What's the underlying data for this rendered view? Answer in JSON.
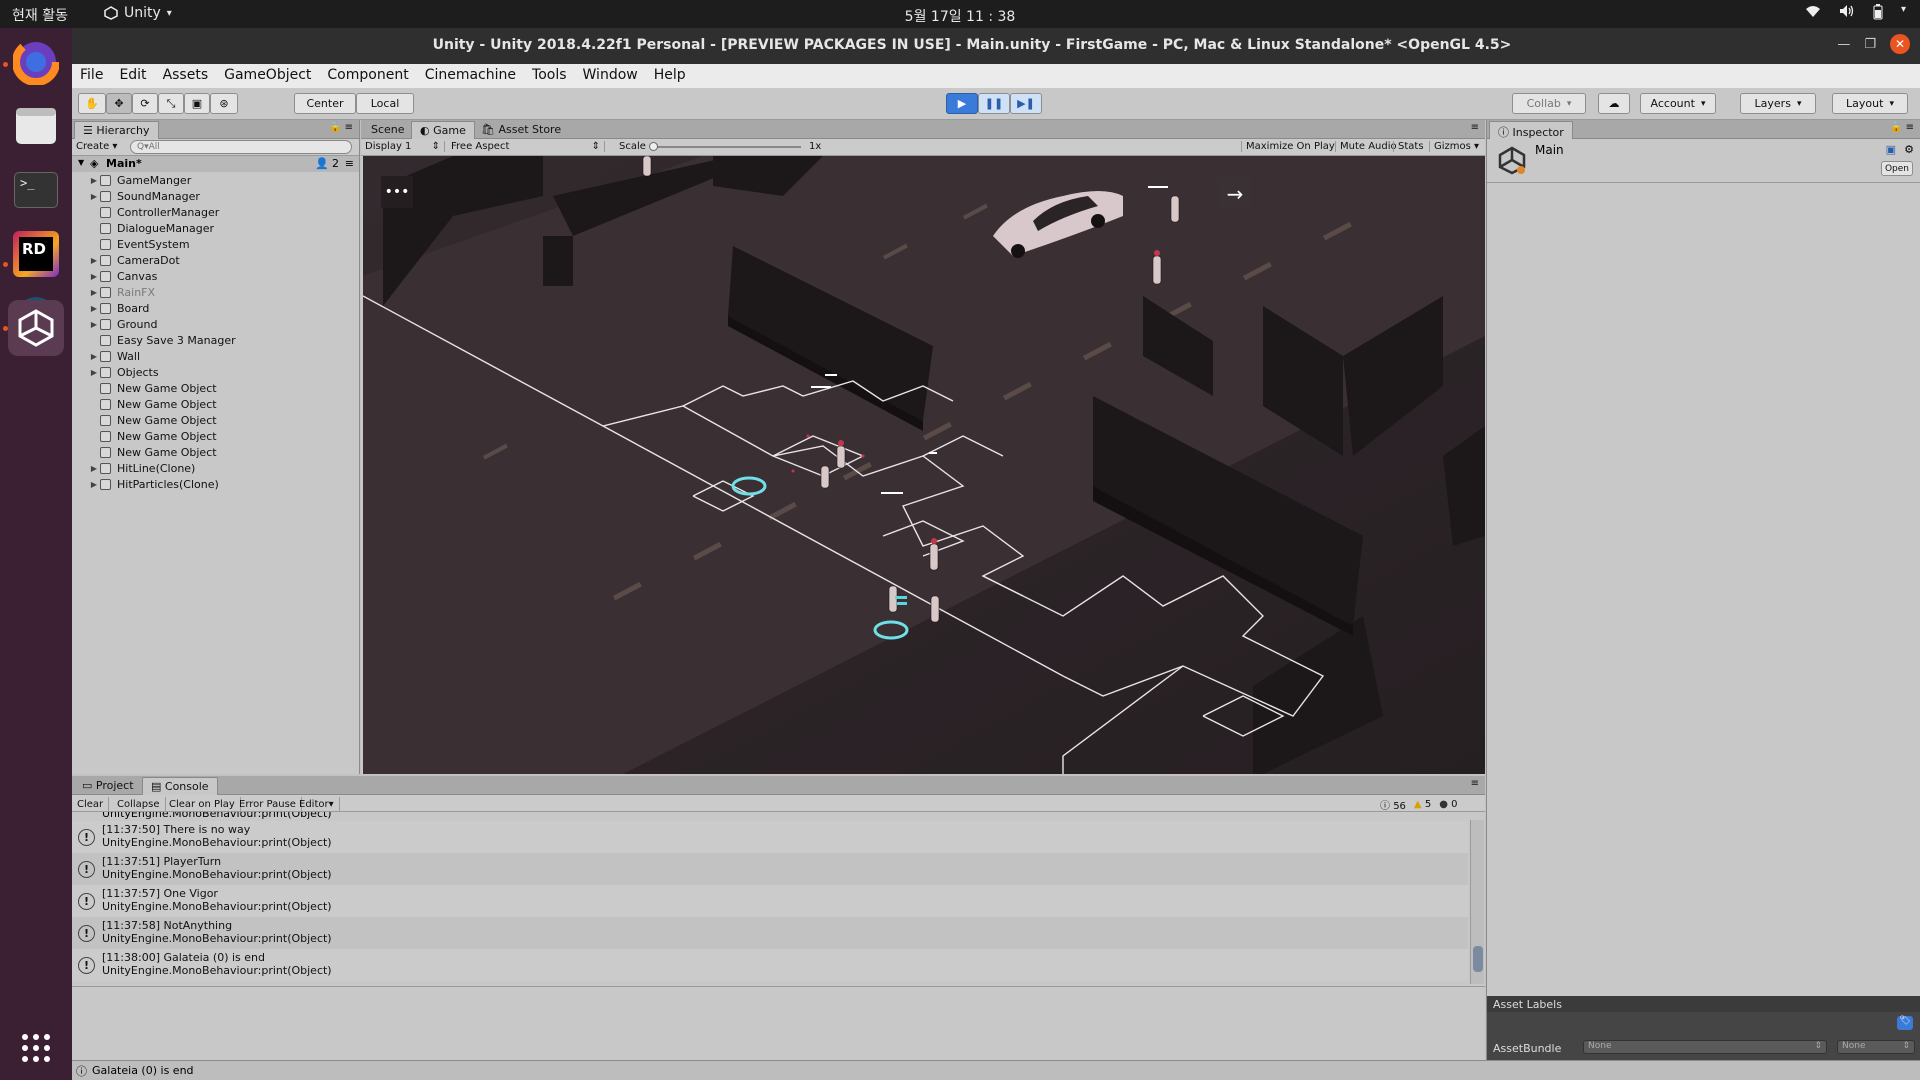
{
  "system": {
    "activities": "현재 활동",
    "app_name": "Unity",
    "clock": "5월 17일 11 : 38"
  },
  "dock": {
    "items": [
      "firefox-icon",
      "files-icon",
      "terminal-icon",
      "rider-icon",
      "steam-icon",
      "unity-icon"
    ],
    "rider_label": "RD",
    "terminal_label": ">_"
  },
  "window": {
    "title": "Unity - Unity 2018.4.22f1 Personal - [PREVIEW PACKAGES IN USE] - Main.unity - FirstGame - PC, Mac & Linux Standalone* <OpenGL 4.5>"
  },
  "menu": [
    "File",
    "Edit",
    "Assets",
    "GameObject",
    "Component",
    "Cinemachine",
    "Tools",
    "Window",
    "Help"
  ],
  "toolbar": {
    "center": "Center",
    "local": "Local",
    "collab": "Collab",
    "account": "Account",
    "layers": "Layers",
    "layout": "Layout"
  },
  "hierarchy": {
    "tab": "Hierarchy",
    "create": "Create",
    "search_placeholder": "Q▾All",
    "scene": "Main*",
    "count": "2",
    "items": [
      {
        "label": "GameManger",
        "expandable": true,
        "dim": false
      },
      {
        "label": "SoundManager",
        "expandable": true,
        "dim": false
      },
      {
        "label": "ControllerManager",
        "expandable": false,
        "dim": false
      },
      {
        "label": "DialogueManager",
        "expandable": false,
        "dim": false
      },
      {
        "label": "EventSystem",
        "expandable": false,
        "dim": false
      },
      {
        "label": "CameraDot",
        "expandable": true,
        "dim": false
      },
      {
        "label": "Canvas",
        "expandable": true,
        "dim": false
      },
      {
        "label": "RainFX",
        "expandable": true,
        "dim": true
      },
      {
        "label": "Board",
        "expandable": true,
        "dim": false
      },
      {
        "label": "Ground",
        "expandable": true,
        "dim": false
      },
      {
        "label": "Easy Save 3 Manager",
        "expandable": false,
        "dim": false
      },
      {
        "label": "Wall",
        "expandable": true,
        "dim": false
      },
      {
        "label": "Objects",
        "expandable": true,
        "dim": false
      },
      {
        "label": "New Game Object",
        "expandable": false,
        "dim": false
      },
      {
        "label": "New Game Object",
        "expandable": false,
        "dim": false
      },
      {
        "label": "New Game Object",
        "expandable": false,
        "dim": false
      },
      {
        "label": "New Game Object",
        "expandable": false,
        "dim": false
      },
      {
        "label": "New Game Object",
        "expandable": false,
        "dim": false
      },
      {
        "label": "HitLine(Clone)",
        "expandable": true,
        "dim": false
      },
      {
        "label": "HitParticles(Clone)",
        "expandable": true,
        "dim": false
      }
    ]
  },
  "game_view": {
    "tabs": [
      "Scene",
      "Game",
      "Asset Store"
    ],
    "display": "Display 1",
    "aspect": "Free Aspect",
    "scale_label": "Scale",
    "scale_value": "1x",
    "buttons": [
      "Maximize On Play",
      "Mute Audio",
      "Stats",
      "Gizmos"
    ],
    "overlay_menu": "•••",
    "overlay_arrow": "→"
  },
  "inspector": {
    "tab": "Inspector",
    "object": "Main",
    "open": "Open",
    "asset_labels": "Asset Labels",
    "asset_bundle": "AssetBundle",
    "none1": "None",
    "none2": "None"
  },
  "console": {
    "tabs": [
      "Project",
      "Console"
    ],
    "buttons": [
      "Clear",
      "Collapse",
      "Clear on Play",
      "Error Pause",
      "Editor"
    ],
    "count_info": "56",
    "count_warn": "5",
    "count_error": "0",
    "partial_line": "UnityEngine.MonoBehaviour:print(Object)",
    "entries": [
      {
        "msg": "[11:37:50] There is no way",
        "trace": "UnityEngine.MonoBehaviour:print(Object)"
      },
      {
        "msg": "[11:37:51] PlayerTurn",
        "trace": "UnityEngine.MonoBehaviour:print(Object)"
      },
      {
        "msg": "[11:37:57] One Vigor",
        "trace": "UnityEngine.MonoBehaviour:print(Object)"
      },
      {
        "msg": "[11:37:58] NotAnything",
        "trace": "UnityEngine.MonoBehaviour:print(Object)"
      },
      {
        "msg": "[11:38:00] Galateia (0) is end",
        "trace": "UnityEngine.MonoBehaviour:print(Object)"
      }
    ]
  },
  "statusbar": {
    "text": "Galateia (0) is end"
  },
  "colors": {
    "accent": "#3a7ad9",
    "ubuntu_orange": "#e95420",
    "scene_bg": "#2e2629",
    "hex_outline": "#e8e4e6",
    "target_ring": "#6fe0e8"
  }
}
